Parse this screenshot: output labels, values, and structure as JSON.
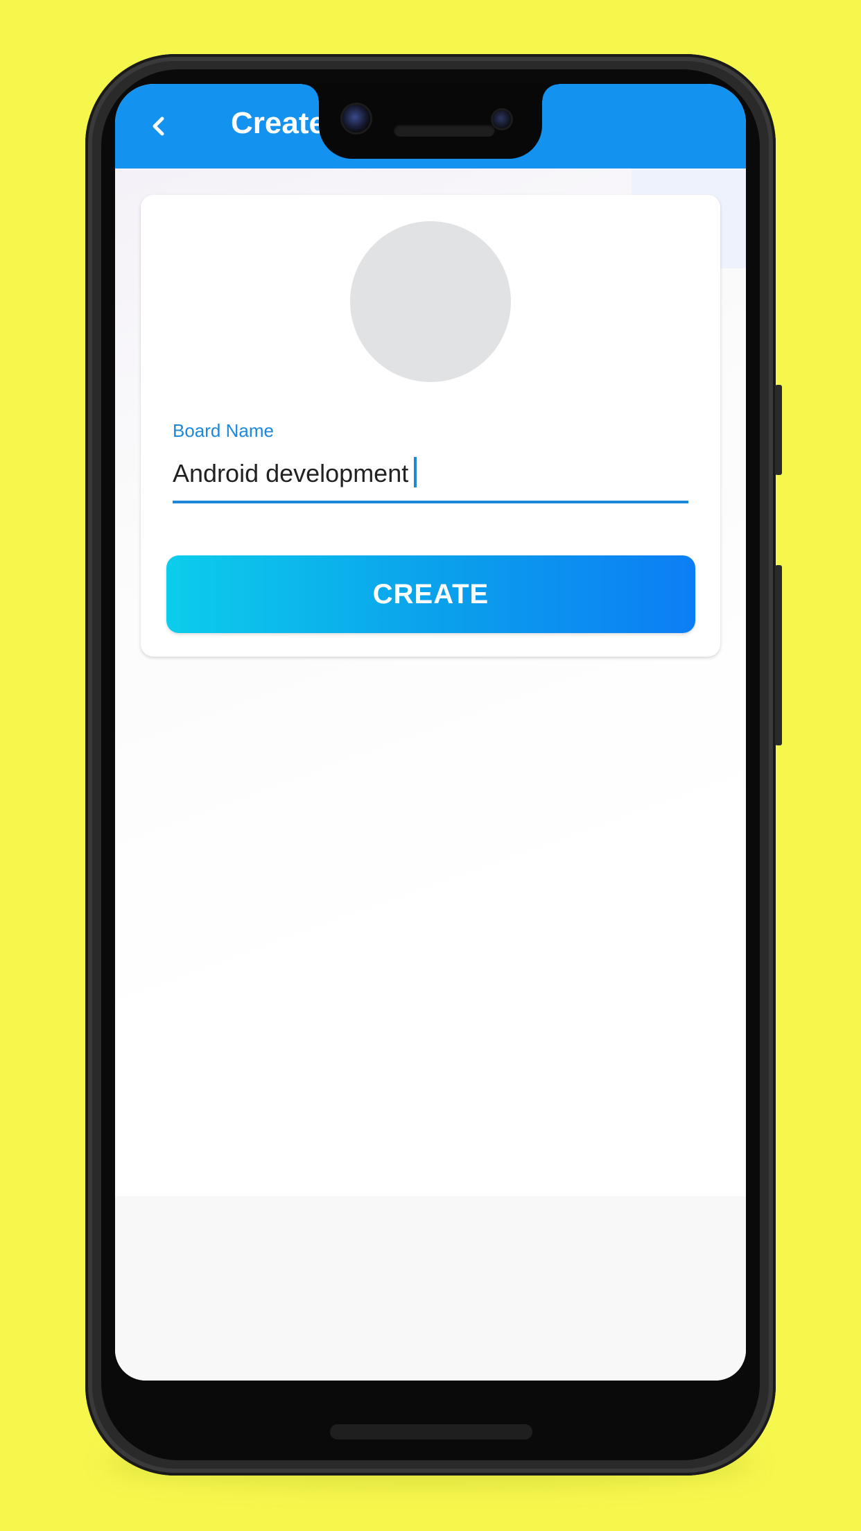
{
  "app_bar": {
    "title": "Create"
  },
  "form": {
    "field_label": "Board Name",
    "field_value": "Android development",
    "submit_label": "CREATE"
  },
  "colors": {
    "background": "#F5F74D",
    "app_bar": "#1392F0",
    "accent": "#1E88D8",
    "button_gradient_start": "#0CCDEB",
    "button_gradient_end": "#0C7EF5",
    "avatar_placeholder": "#E1E2E4"
  },
  "icons": {
    "back": "chevron-left-icon"
  }
}
